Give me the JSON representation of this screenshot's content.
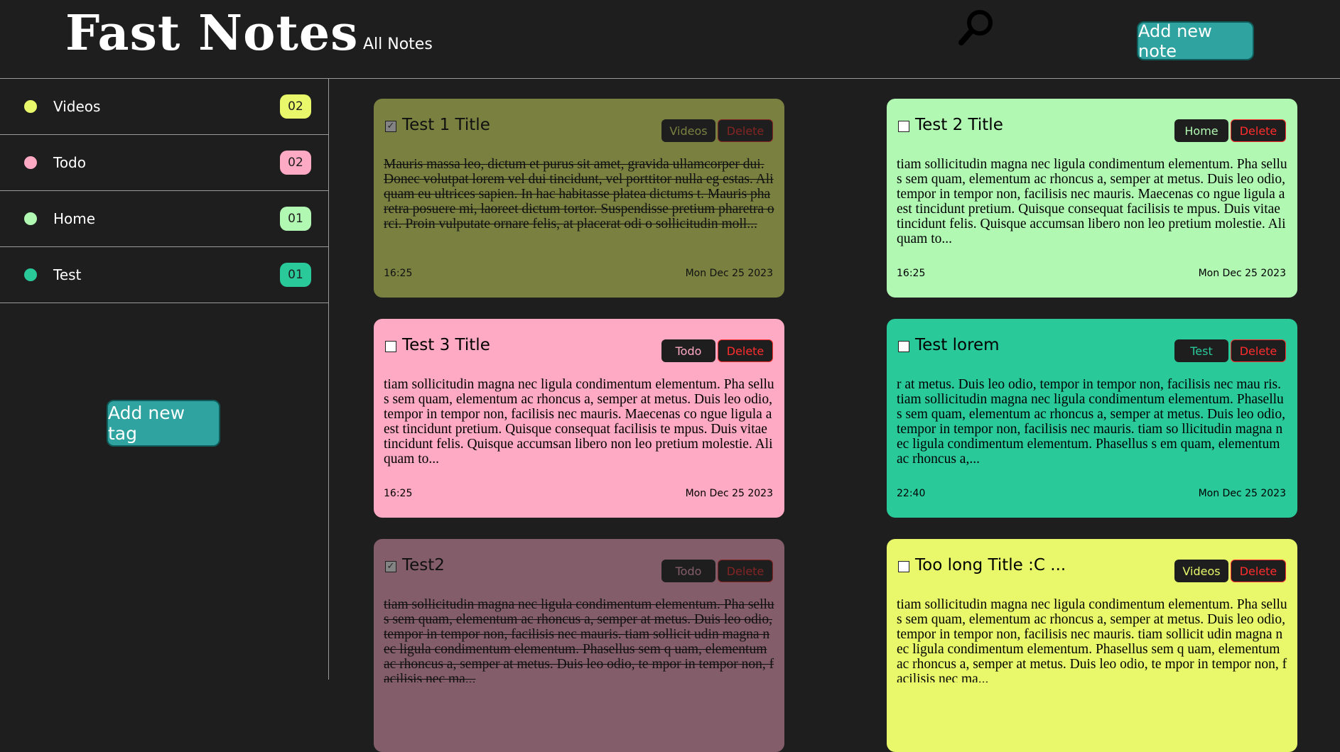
{
  "header": {
    "brand": "Fast Notes",
    "nav_all_notes": "All Notes",
    "search_icon": "search-icon",
    "add_note_label": "Add new note"
  },
  "sidebar": {
    "tags": [
      {
        "label": "Videos",
        "count": "02",
        "color": "#e8f86a"
      },
      {
        "label": "Todo",
        "count": "02",
        "color": "#ffaac5"
      },
      {
        "label": "Home",
        "count": "01",
        "color": "#b1f8b3"
      },
      {
        "label": "Test",
        "count": "01",
        "color": "#29c99a"
      }
    ],
    "add_tag_label": "Add new tag"
  },
  "notes": [
    {
      "title": "Test 1 Title",
      "checked": true,
      "tag": "Videos",
      "delete_label": "Delete",
      "body": "Mauris massa leo, dictum et purus sit amet, gravida ullamcorper dui. Donec volutpat lorem vel dui tincidunt, vel porttitor nulla eg estas. Aliquam eu ultrices sapien. In hac habitasse platea dictums t. Mauris pharetra posuere mi, laoreet dictum tortor. Suspendisse pretium pharetra orci. Proin vulputate ornare felis, at placerat odi o sollicitudin moll...",
      "time": "16:25",
      "date": "Mon Dec 25 2023",
      "color": "#e8f86a",
      "tag_text_color": "#e8f86a"
    },
    {
      "title": "Test 2 Title",
      "checked": false,
      "tag": "Home",
      "delete_label": "Delete",
      "body": "tiam sollicitudin magna nec ligula condimentum elementum. Pha sellus sem quam, elementum ac rhoncus a, semper at metus. Duis leo odio, tempor in tempor non, facilisis nec mauris. Maecenas co ngue ligula a est tincidunt pretium. Quisque consequat facilisis te mpus. Duis vitae tincidunt felis. Quisque accumsan libero non leo pretium molestie. Aliquam to...",
      "time": "16:25",
      "date": "Mon Dec 25 2023",
      "color": "#b1f8b3",
      "tag_text_color": "#b1f8b3"
    },
    {
      "title": "Test 3 Title",
      "checked": false,
      "tag": "Todo",
      "delete_label": "Delete",
      "body": "tiam sollicitudin magna nec ligula condimentum elementum. Pha sellus sem quam, elementum ac rhoncus a, semper at metus. Duis leo odio, tempor in tempor non, facilisis nec mauris. Maecenas co ngue ligula a est tincidunt pretium. Quisque consequat facilisis te mpus. Duis vitae tincidunt felis. Quisque accumsan libero non leo pretium molestie. Aliquam to...",
      "time": "16:25",
      "date": "Mon Dec 25 2023",
      "color": "#ffaac5",
      "tag_text_color": "#ffaac5"
    },
    {
      "title": "Test lorem",
      "checked": false,
      "tag": "Test",
      "delete_label": "Delete",
      "body": "r at metus. Duis leo odio, tempor in tempor non, facilisis nec mau ris. tiam sollicitudin magna nec ligula condimentum elementum. Phasellus sem quam, elementum ac rhoncus a, semper at metus. Duis leo odio, tempor in tempor non, facilisis nec mauris. tiam so llicitudin magna nec ligula condimentum elementum. Phasellus s em quam, elementum ac rhoncus a,...",
      "time": "22:40",
      "date": "Mon Dec 25 2023",
      "color": "#29c99a",
      "tag_text_color": "#29c99a"
    },
    {
      "title": "Test2",
      "checked": true,
      "tag": "Todo",
      "delete_label": "Delete",
      "body": "tiam sollicitudin magna nec ligula condimentum elementum. Pha sellus sem quam, elementum ac rhoncus a, semper at metus. Duis leo odio, tempor in tempor non, facilisis nec mauris. tiam sollicit udin magna nec ligula condimentum elementum. Phasellus sem q uam, elementum ac rhoncus a, semper at metus. Duis leo odio, te mpor in tempor non, facilisis nec ma...",
      "time": "",
      "date": "",
      "color": "#ffaac5",
      "tag_text_color": "#ffaac5"
    },
    {
      "title": "Too long Title :C ...",
      "checked": false,
      "tag": "Videos",
      "delete_label": "Delete",
      "body": "tiam sollicitudin magna nec ligula condimentum elementum. Pha sellus sem quam, elementum ac rhoncus a, semper at metus. Duis leo odio, tempor in tempor non, facilisis nec mauris. tiam sollicit udin magna nec ligula condimentum elementum. Phasellus sem q uam, elementum ac rhoncus a, semper at metus. Duis leo odio, te mpor in tempor non, facilisis nec ma...",
      "time": "",
      "date": "",
      "color": "#e8f86a",
      "tag_text_color": "#e8f86a"
    }
  ]
}
